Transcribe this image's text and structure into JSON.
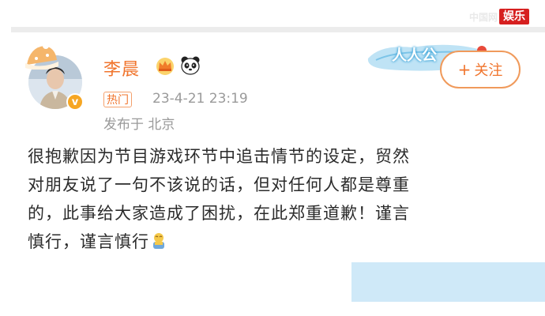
{
  "watermark": {
    "faded_text": "中国网",
    "badge": "娱乐"
  },
  "user": {
    "name": "李晨",
    "verified_mark": "v"
  },
  "meta": {
    "hot_tag": "热门",
    "timestamp": "23-4-21 23:19",
    "location": "发布于 北京"
  },
  "promo": {
    "text": "人人公"
  },
  "follow": {
    "plus": "+",
    "label": "关注"
  },
  "post": {
    "lines": [
      "很抱歉因为节目游戏环节中追击情节的设定，贸然",
      "对朋友说了一句不该说的话，但对任何人都是尊重",
      "的，此事给大家造成了困扰，在此郑重道歉！谨言",
      "慎行，谨言慎行"
    ]
  },
  "icons": {
    "crown": "crown-icon",
    "panda": "panda-icon",
    "hat": "hat-icon",
    "emoji": "bowing-emoji-icon"
  },
  "colors": {
    "accent": "#f0742c",
    "meta_gray": "#9a9a9a",
    "highlight_box": "#cfe9f8",
    "badge_red": "#d61f1f"
  }
}
